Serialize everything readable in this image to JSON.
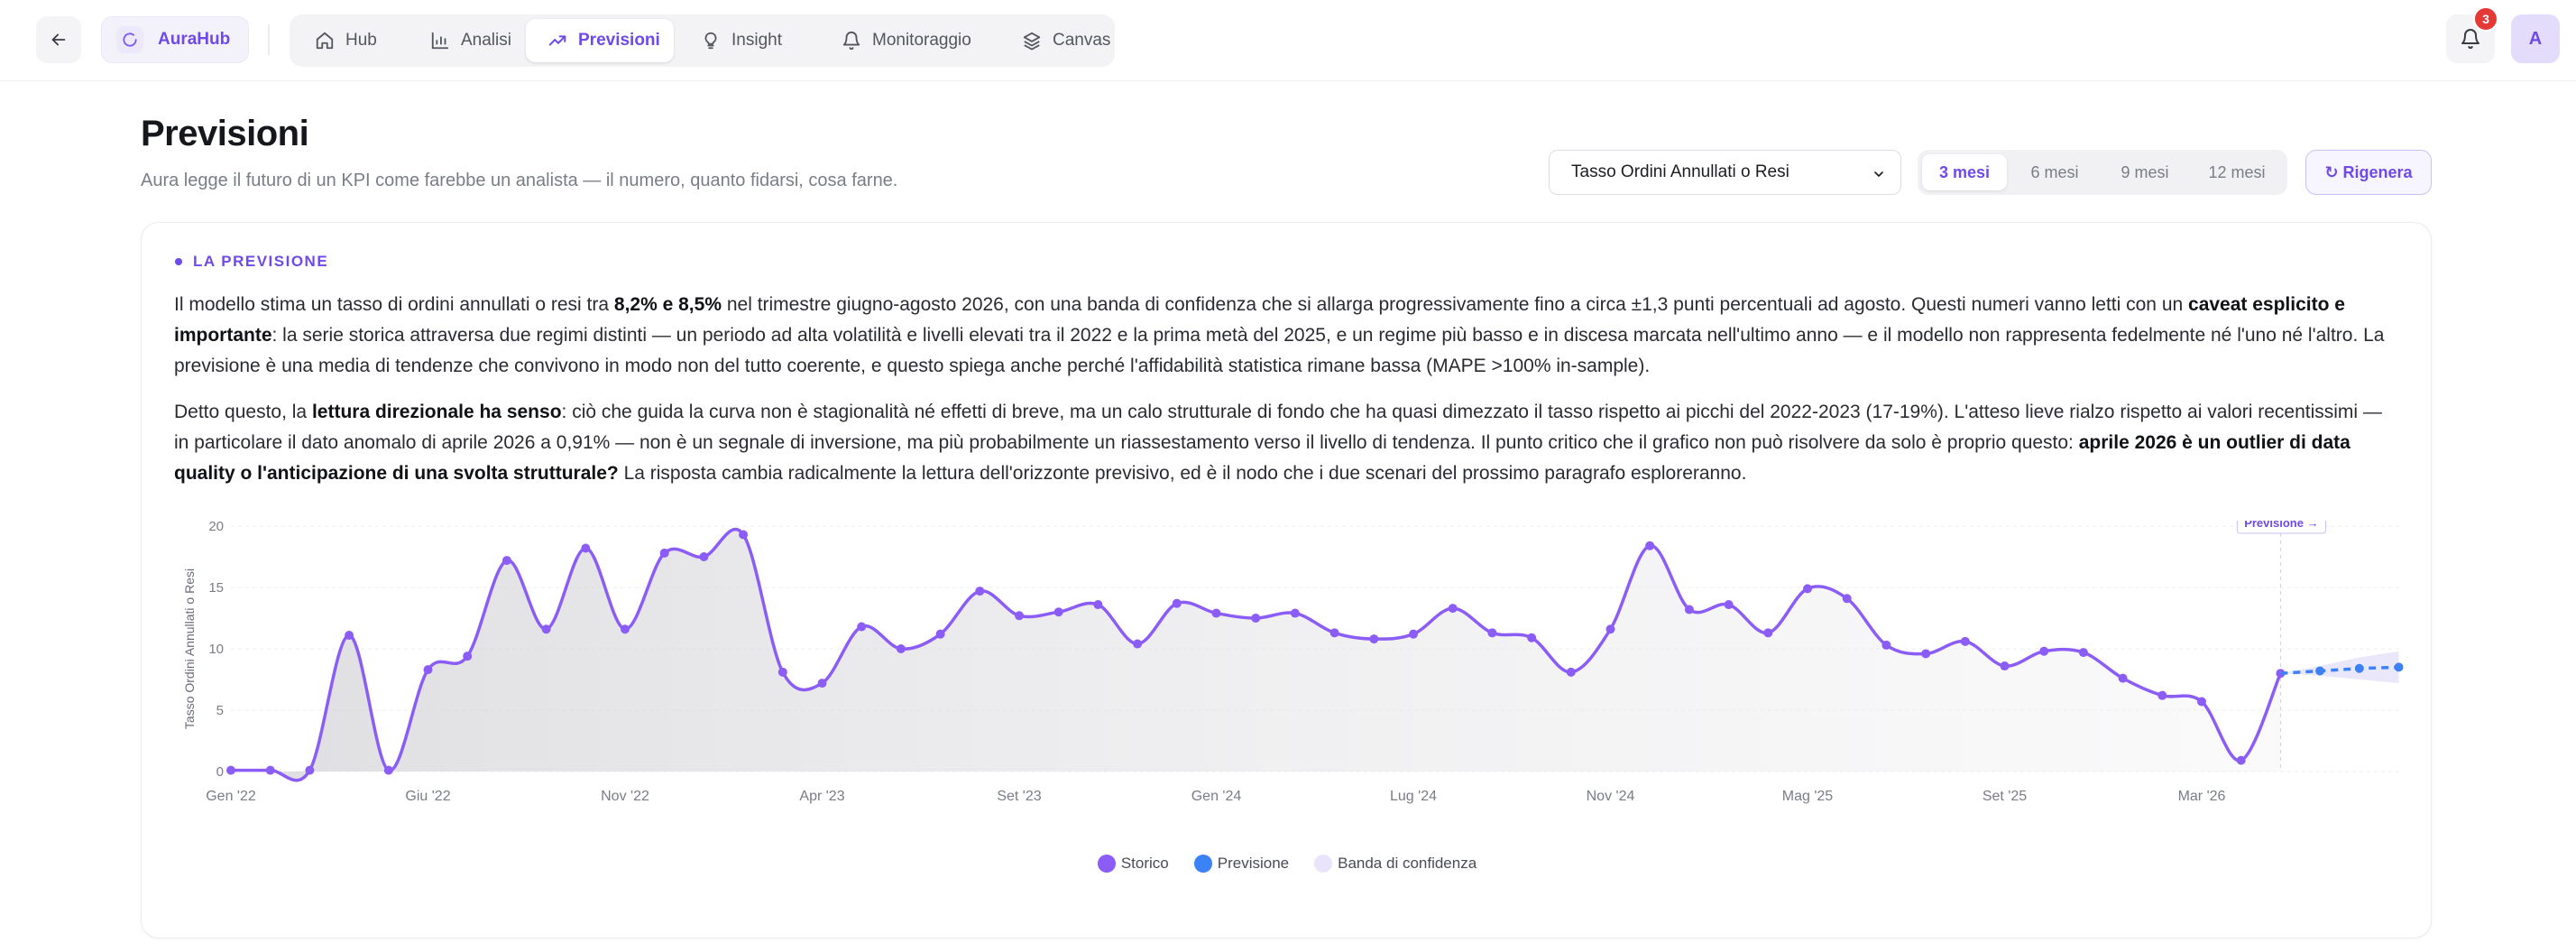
{
  "app": {
    "name": "AuraHub",
    "notifications": "3",
    "avatar_initial": "A"
  },
  "nav": {
    "items": [
      {
        "label": "Hub",
        "icon": "home-icon"
      },
      {
        "label": "Analisi",
        "icon": "bar-chart-icon"
      },
      {
        "label": "Previsioni",
        "icon": "trend-up-icon",
        "active": true
      },
      {
        "label": "Insight",
        "icon": "lightbulb-icon"
      },
      {
        "label": "Monitoraggio",
        "icon": "bell-icon"
      },
      {
        "label": "Canvas",
        "icon": "layers-icon"
      }
    ]
  },
  "header": {
    "title": "Previsioni",
    "subtitle": "Aura legge il futuro di un KPI come farebbe un analista — il numero, quanto fidarsi, cosa farne."
  },
  "controls": {
    "kpi_selected": "Tasso Ordini Annullati o Resi",
    "horizons": [
      "3 mesi",
      "6 mesi",
      "9 mesi",
      "12 mesi"
    ],
    "horizon_active": "3 mesi",
    "regenerate_label": "↻ Rigenera"
  },
  "forecast": {
    "section_label": "LA PREVISIONE",
    "p1": [
      "Il modello stima un tasso di ordini annullati o resi tra ",
      "8,2% e 8,5%",
      " nel trimestre giugno-agosto 2026, con una banda di confidenza che si allarga progressivamente fino a circa ±1,3 punti percentuali ad agosto. Questi numeri vanno letti con un ",
      "caveat esplicito e importante",
      ": la serie storica attraversa due regimi distinti — un periodo ad alta volatilità e livelli elevati tra il 2022 e la prima metà del 2025, e un regime più basso e in discesa marcata nell'ultimo anno — e il modello non rappresenta fedelmente né l'uno né l'altro. La previsione è una media di tendenze che convivono in modo non del tutto coerente, e questo spiega anche perché l'affidabilità statistica rimane bassa (MAPE >100% in-sample)."
    ],
    "p2": [
      "Detto questo, la ",
      "lettura direzionale ha senso",
      ": ciò che guida la curva non è stagionalità né effetti di breve, ma un calo strutturale di fondo che ha quasi dimezzato il tasso rispetto ai picchi del 2022-2023 (17-19%). L'atteso lieve rialzo rispetto ai valori recentissimi — in particolare il dato anomalo di aprile 2026 a 0,91% — non è un segnale di inversione, ma più probabilmente un riassestamento verso il livello di tendenza. Il punto critico che il grafico non può risolvere da solo è proprio questo: ",
      "aprile 2026 è un outlier di data quality o l'anticipazione di una svolta strutturale?",
      " La risposta cambia radicalmente la lettura dell'orizzonte previsivo, ed è il nodo che i due scenari del prossimo paragrafo esploreranno."
    ]
  },
  "chart_data": {
    "type": "area",
    "ylabel": "Tasso Ordini Annullati o Resi",
    "ylim": [
      0,
      20
    ],
    "yticks": [
      0,
      5,
      10,
      15,
      20
    ],
    "xticks": [
      "Gen '22",
      "Giu '22",
      "Nov '22",
      "Apr '23",
      "Set '23",
      "Gen '24",
      "Lug '24",
      "Nov '24",
      "Mag '25",
      "Set '25",
      "Mar '26"
    ],
    "forecast_marker": "Previsione →",
    "legend": [
      "Storico",
      "Previsione",
      "Banda di confidenza"
    ],
    "colors": {
      "historical": "#8b5cf6",
      "forecast": "#3b82f6",
      "band": "#e9e4fb"
    },
    "historical": [
      0.1,
      0.1,
      0.1,
      11.1,
      0.1,
      8.3,
      9.4,
      17.2,
      11.6,
      18.2,
      11.6,
      17.8,
      17.5,
      19.3,
      8.1,
      7.2,
      11.8,
      10.0,
      11.2,
      14.7,
      12.7,
      13.0,
      13.6,
      10.4,
      13.7,
      12.9,
      12.5,
      12.9,
      11.3,
      10.8,
      11.2,
      13.3,
      11.3,
      10.9,
      8.1,
      11.6,
      18.4,
      13.2,
      13.6,
      11.3,
      14.9,
      14.1,
      10.3,
      9.6,
      10.6,
      8.6,
      9.8,
      9.7,
      7.6,
      6.2,
      5.7,
      0.91,
      8.0
    ],
    "forecast": [
      8.2,
      8.4,
      8.5
    ],
    "band_lower": [
      7.8,
      7.5,
      7.2
    ],
    "band_upper": [
      8.6,
      9.3,
      9.8
    ]
  }
}
